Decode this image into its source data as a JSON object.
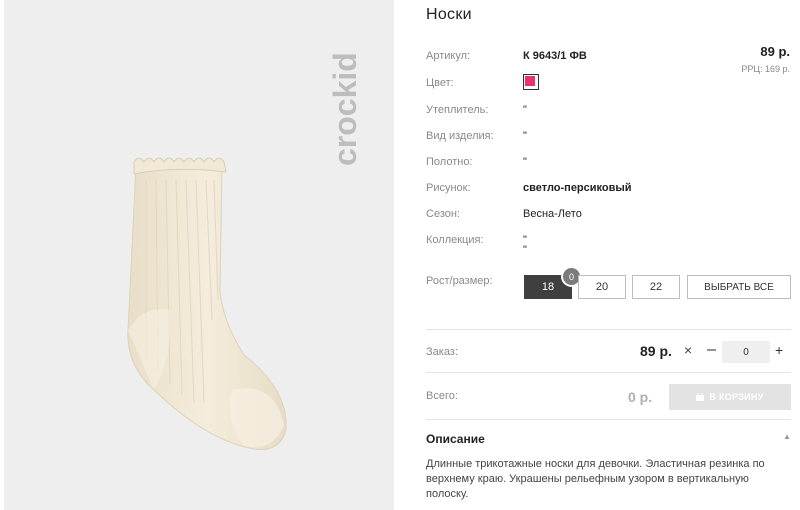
{
  "product": {
    "title": "Носки",
    "brand": "crockid",
    "price": "89 р.",
    "rrc": "РРЦ: 169 р."
  },
  "attributes": [
    {
      "label": "Артикул:",
      "value": "К 9643/1 ФВ"
    },
    {
      "label": "Цвет:",
      "swatch_color": "#e8336e"
    },
    {
      "label": "Утеплитель:",
      "value": "\""
    },
    {
      "label": "Вид изделия:",
      "value": "\""
    },
    {
      "label": "Полотно:",
      "value": "\""
    },
    {
      "label": "Рисунок:",
      "value": "светло-персиковый"
    },
    {
      "label": "Сезон:",
      "value": "Весна-Лето"
    },
    {
      "label": "Коллекция:",
      "value": "\"",
      "value2": "\""
    }
  ],
  "sizes": {
    "label": "Рост/размер:",
    "options": [
      "18",
      "20",
      "22"
    ],
    "selected": "18",
    "badge": "0",
    "select_all": "ВЫБРАТЬ ВСЕ"
  },
  "order": {
    "label": "Заказ:",
    "price": "89 р.",
    "times": "×",
    "minus": "–",
    "qty": "0",
    "plus": "+"
  },
  "total": {
    "label": "Всего:",
    "value": "0 р.",
    "cart_button": "В КОРЗИНУ"
  },
  "description": {
    "title": "Описание",
    "text": "Длинные трикотажные носки для девочки. Эластичная резинка по верхнему краю. Украшены рельефным узором в вертикальную полоску."
  },
  "colors": {
    "photo_bg": "#eeeeee",
    "sock": "#f3ead8",
    "swatch": "#e8336e",
    "active_size": "#3f3f3f"
  }
}
